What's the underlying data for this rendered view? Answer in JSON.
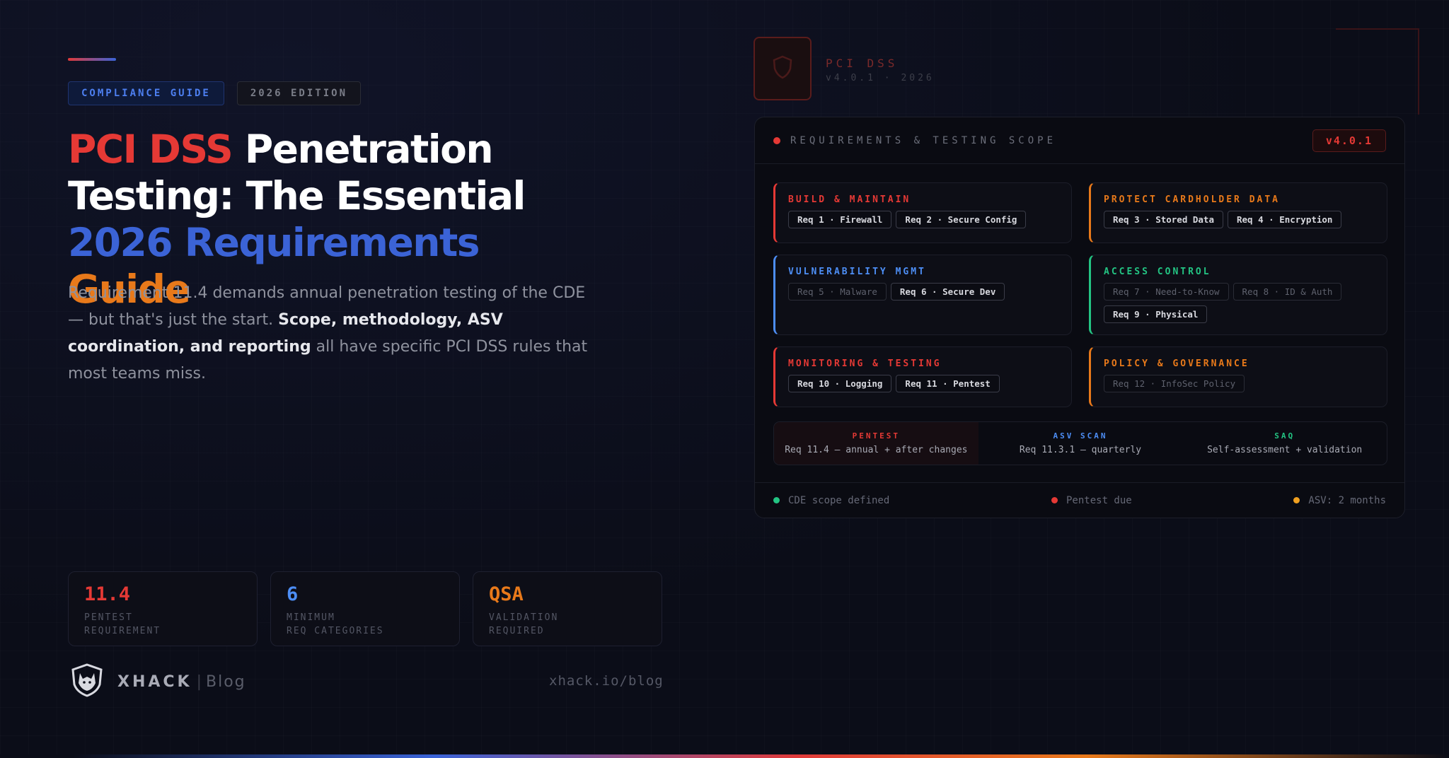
{
  "badges": {
    "guide": "COMPLIANCE GUIDE",
    "edition": "2026 EDITION"
  },
  "headline": {
    "part1_red": "PCI DSS",
    "part1_white": " Penetration",
    "line2": "Testing: The Essential",
    "line3_blue": "2026 Requirements",
    "line3_orange": "Guide"
  },
  "description": {
    "intro": "Requirement 11.4 demands annual penetration testing of the CDE — but that's just the start. ",
    "bold": "Scope, methodology, ASV coordination, and reporting",
    "outro": " all have specific PCI DSS rules that most teams miss."
  },
  "stats": [
    {
      "value": "11.4",
      "label": "PENTEST\nREQUIREMENT",
      "color": "#e53935"
    },
    {
      "value": "6",
      "label": "MINIMUM\nREQ CATEGORIES",
      "color": "#4d8ef5"
    },
    {
      "value": "QSA",
      "label": "VALIDATION\nREQUIRED",
      "color": "#e8791a"
    }
  ],
  "brand": {
    "name": "XHACK",
    "separator": "|",
    "blog": "Blog",
    "url": "xhack.io/blog",
    "logo_icon": "wolf-shield-icon"
  },
  "header": {
    "title": "PCI DSS",
    "subtitle": "v4.0.1 · 2026"
  },
  "panel": {
    "title": "REQUIREMENTS & TESTING SCOPE",
    "version": "v4.0.1",
    "categories": [
      {
        "title": "BUILD & MAINTAIN",
        "color": "#e53935",
        "chips": [
          {
            "text": "Req 1 · Firewall",
            "dim": false
          },
          {
            "text": "Req 2 · Secure Config",
            "dim": false
          }
        ]
      },
      {
        "title": "PROTECT CARDHOLDER DATA",
        "color": "#e8791a",
        "chips": [
          {
            "text": "Req 3 · Stored Data",
            "dim": false
          },
          {
            "text": "Req 4 · Encryption",
            "dim": false
          }
        ]
      },
      {
        "title": "VULNERABILITY MGMT",
        "color": "#4d8ef5",
        "chips": [
          {
            "text": "Req 5 · Malware",
            "dim": true
          },
          {
            "text": "Req 6 · Secure Dev",
            "dim": false
          }
        ]
      },
      {
        "title": "ACCESS CONTROL",
        "color": "#23c483",
        "chips": [
          {
            "text": "Req 7 · Need-to-Know",
            "dim": true
          },
          {
            "text": "Req 8 · ID & Auth",
            "dim": true
          },
          {
            "text": "Req 9 · Physical",
            "dim": false
          }
        ]
      },
      {
        "title": "MONITORING & TESTING",
        "color": "#e53935",
        "chips": [
          {
            "text": "Req 10 · Logging",
            "dim": false
          },
          {
            "text": "Req 11 · Pentest",
            "dim": false
          }
        ]
      },
      {
        "title": "POLICY & GOVERNANCE",
        "color": "#e8791a",
        "chips": [
          {
            "text": "Req 12 · InfoSec Policy",
            "dim": true
          }
        ]
      }
    ],
    "summary": [
      {
        "label": "PENTEST",
        "value": "Req 11.4 — annual + after changes",
        "color": "#e53935"
      },
      {
        "label": "ASV SCAN",
        "value": "Req 11.3.1 — quarterly",
        "color": "#4d8ef5"
      },
      {
        "label": "SAQ",
        "value": "Self-assessment + validation",
        "color": "#23c483"
      }
    ],
    "footer": [
      {
        "text": "CDE scope defined",
        "color": "#23c483"
      },
      {
        "text": "Pentest due",
        "color": "#e53935"
      },
      {
        "text": "ASV: 2 months",
        "color": "#f0a020"
      }
    ]
  }
}
